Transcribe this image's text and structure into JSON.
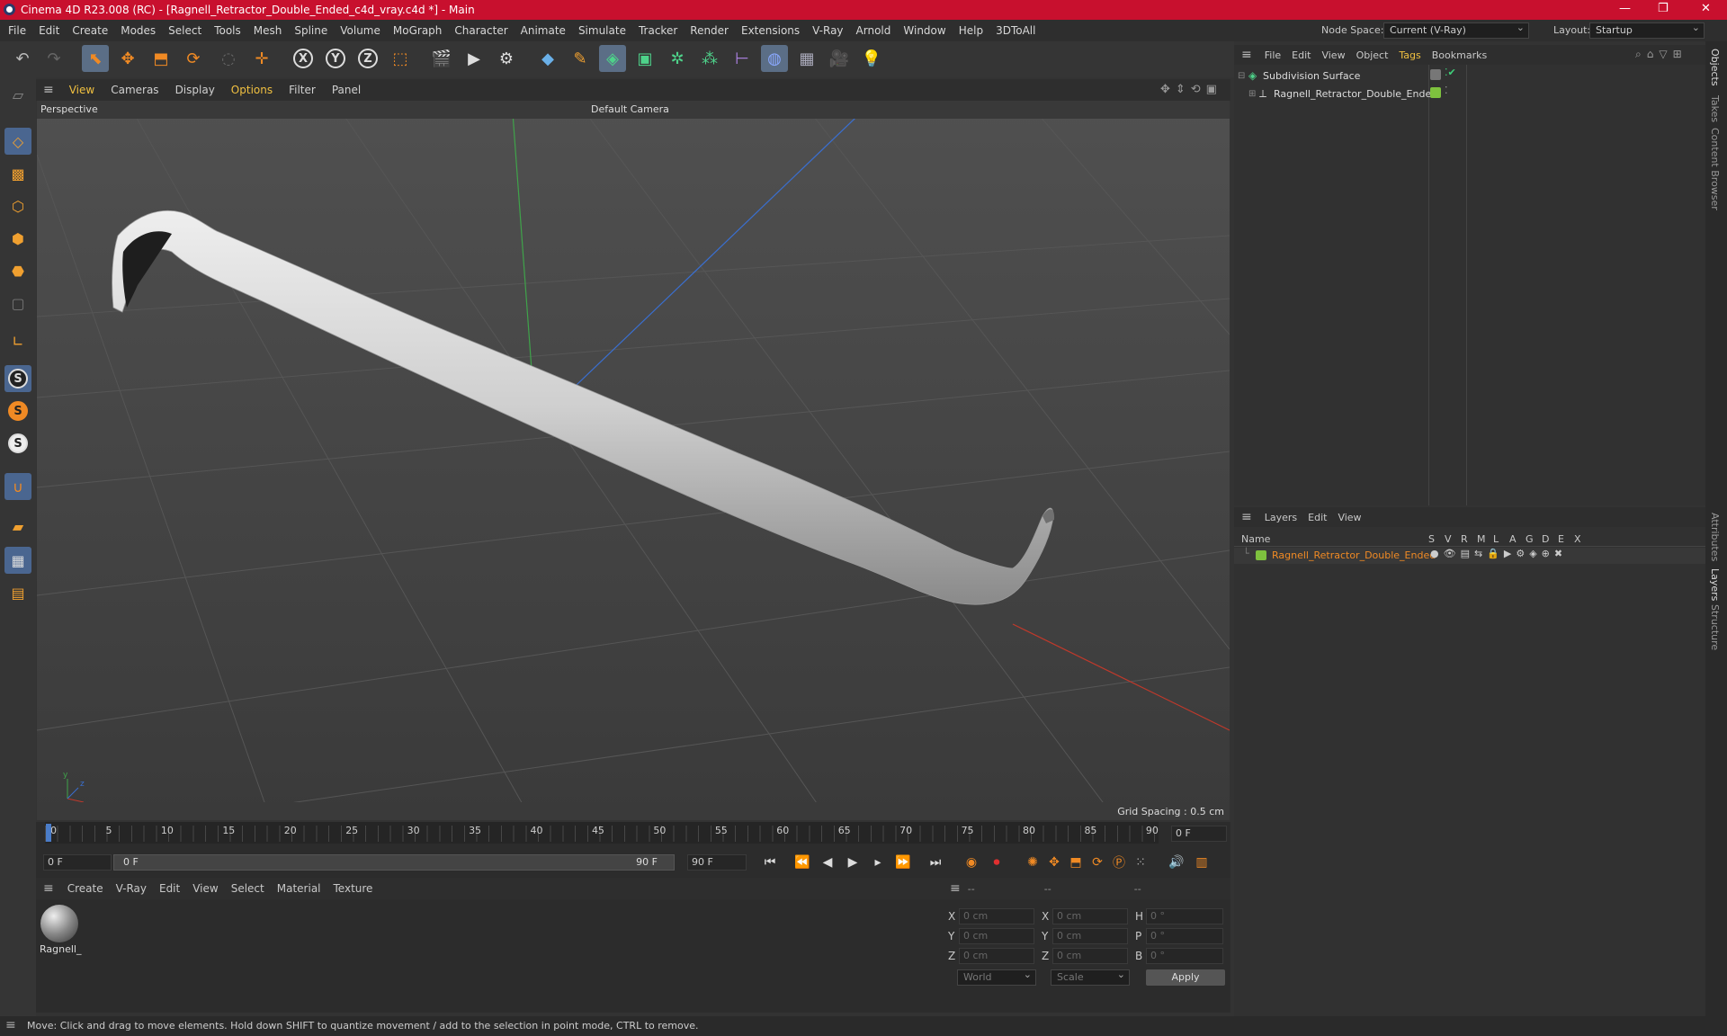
{
  "title": "Cinema 4D R23.008 (RC) - [Ragnell_Retractor_Double_Ended_c4d_vray.c4d *] - Main",
  "menu": [
    "File",
    "Edit",
    "Create",
    "Modes",
    "Select",
    "Tools",
    "Mesh",
    "Spline",
    "Volume",
    "MoGraph",
    "Character",
    "Animate",
    "Simulate",
    "Tracker",
    "Render",
    "Extensions",
    "V-Ray",
    "Arnold",
    "Window",
    "Help",
    "3DToAll"
  ],
  "node_space_label": "Node Space:",
  "node_space_value": "Current (V-Ray)",
  "layout_label": "Layout:",
  "layout_value": "Startup",
  "viewport": {
    "menu": [
      "View",
      "Cameras",
      "Display",
      "Options",
      "Filter",
      "Panel"
    ],
    "name": "Perspective",
    "camera": "Default Camera",
    "grid_spacing": "Grid Spacing : 0.5 cm"
  },
  "objects": {
    "menu": [
      "File",
      "Edit",
      "View",
      "Object",
      "Tags",
      "Bookmarks"
    ],
    "items": [
      {
        "name": "Subdivision Surface"
      },
      {
        "name": "Ragnell_Retractor_Double_Ended"
      }
    ]
  },
  "layers": {
    "menu": [
      "Layers",
      "Edit",
      "View"
    ],
    "name_header": "Name",
    "columns": [
      "S",
      "V",
      "R",
      "M",
      "L",
      "A",
      "G",
      "D",
      "E",
      "X"
    ],
    "item": "Ragnell_Retractor_Double_Ended"
  },
  "timeline": {
    "ticks": [
      "0",
      "5",
      "10",
      "15",
      "20",
      "25",
      "30",
      "35",
      "40",
      "45",
      "50",
      "55",
      "60",
      "65",
      "70",
      "75",
      "80",
      "85",
      "90"
    ],
    "frame_right": "0 F",
    "start": "0 F",
    "range_start": "0 F",
    "range_end": "90 F",
    "end": "90 F"
  },
  "materials": {
    "menu": [
      "Create",
      "V-Ray",
      "Edit",
      "View",
      "Select",
      "Material",
      "Texture"
    ],
    "item": "Ragnell_"
  },
  "coords": {
    "dashes": [
      "--",
      "--",
      "--"
    ],
    "rows": [
      {
        "a": "X",
        "av": "0 cm",
        "b": "X",
        "bv": "0 cm",
        "c": "H",
        "cv": "0 °"
      },
      {
        "a": "Y",
        "av": "0 cm",
        "b": "Y",
        "bv": "0 cm",
        "c": "P",
        "cv": "0 °"
      },
      {
        "a": "Z",
        "av": "0 cm",
        "b": "Z",
        "bv": "0 cm",
        "c": "B",
        "cv": "0 °"
      }
    ],
    "world": "World",
    "scale": "Scale",
    "apply": "Apply"
  },
  "side_tabs": [
    "Objects",
    "Takes",
    "Content Browser",
    "Attributes",
    "Layers",
    "Structure"
  ],
  "status": "Move: Click and drag to move elements. Hold down SHIFT to quantize movement / add to the selection in point mode, CTRL to remove.",
  "colors": {
    "title_bg": "#c8102e",
    "accent_orange": "#f08a24",
    "layer_green": "#7ec13e"
  }
}
